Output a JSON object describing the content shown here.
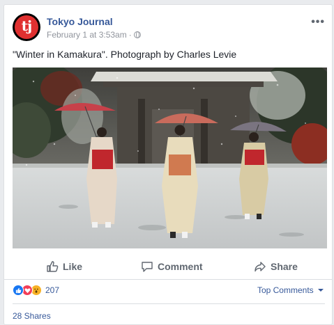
{
  "post": {
    "page_name": "Tokyo Journal",
    "avatar_text": "tj",
    "timestamp": "February 1 at 3:53am",
    "separator": "·",
    "privacy_icon": "globe-icon",
    "more_icon": "more-options-icon",
    "caption": "\"Winter in Kamakura\". Photograph by Charles Levie",
    "photo_alt": "Three women in kimonos walking with umbrellas through a snowy temple grounds"
  },
  "actions": {
    "like_label": "Like",
    "comment_label": "Comment",
    "share_label": "Share"
  },
  "stats": {
    "reaction_icons": [
      "like-icon",
      "love-icon",
      "wow-icon"
    ],
    "reaction_count": "207",
    "top_comments_label": "Top Comments",
    "shares_label": "28 Shares"
  },
  "colors": {
    "link_blue": "#365899",
    "muted_gray": "#606770",
    "like_blue": "#1877f2",
    "love_red": "#f33e58",
    "wow_yellow": "#f7b125"
  }
}
